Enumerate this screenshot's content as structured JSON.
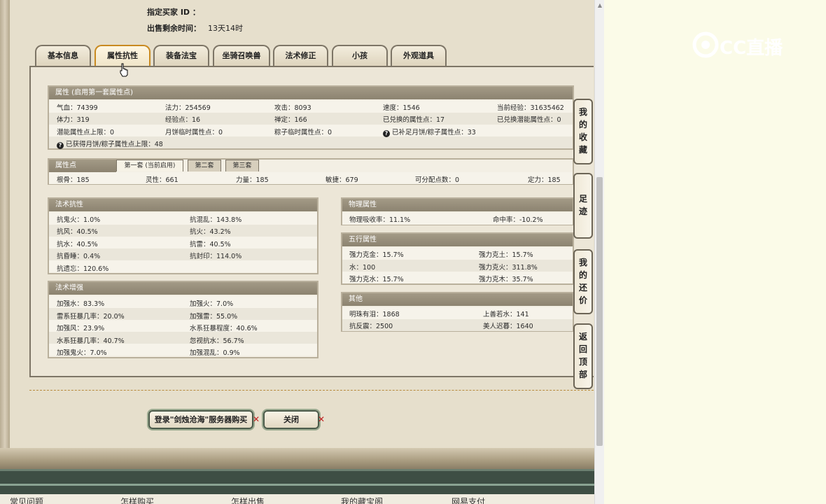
{
  "header": {
    "buyer_id_label": "指定买家 ID ：",
    "time_label": "出售剩余时间：",
    "time_value": "13天14时"
  },
  "tabs": [
    "基本信息",
    "属性抗性",
    "装备法宝",
    "坐骑召唤兽",
    "法术修正",
    "小孩",
    "外观道具"
  ],
  "active_tab": "属性抗性",
  "attributes": {
    "title": "属性 (启用第一套属性点)",
    "items": [
      "气血：74399",
      "法力：254569",
      "攻击：8093",
      "速度：1546",
      "当前经验：31635462",
      "体力：319",
      "经验点：16",
      "禅定：166",
      "已兑换的属性点：17",
      "已兑换潜能属性点：0",
      "潜能属性点上限：0",
      "月饼临时属性点：0",
      "粽子临时属性点：0",
      "已补足月饼/粽子属性点：33",
      "已获得月饼/粽子属性点上限：48"
    ]
  },
  "points": {
    "title": "属性点",
    "subtabs": [
      "第一套 (当前启用)",
      "第二套",
      "第三套"
    ],
    "items": [
      "根骨：185",
      "灵性：661",
      "力量：185",
      "敏捷：679",
      "可分配点数：0",
      "定力：185"
    ]
  },
  "resist": {
    "title": "法术抗性",
    "items": [
      "抗鬼火：1.0%",
      "抗混乱：143.8%",
      "抗风：40.5%",
      "抗火：43.2%",
      "抗水：40.5%",
      "抗雷：40.5%",
      "抗昏睡：0.4%",
      "抗封印：114.0%",
      "抗遗忘：120.6%"
    ]
  },
  "enhance": {
    "title": "法术增强",
    "items": [
      "加强水：83.3%",
      "加强火：7.0%",
      "雷系狂暴几率：20.0%",
      "加强雷：55.0%",
      "加强风：23.9%",
      "水系狂暴程度：40.6%",
      "水系狂暴几率：40.7%",
      "忽视抗水：56.7%",
      "加强鬼火：7.0%",
      "加强混乱：0.9%"
    ]
  },
  "physical": {
    "title": "物理属性",
    "items": [
      "物理吸收率：11.1%",
      "命中率：-10.2%"
    ]
  },
  "wuxing": {
    "title": "五行属性",
    "items": [
      "强力克金：15.7%",
      "强力克土：15.7%",
      "水：100",
      "强力克火：311.8%",
      "强力克水：15.7%",
      "强力克木：35.7%"
    ]
  },
  "other": {
    "title": "其他",
    "items": [
      "明珠有泪：1868",
      "上善若水：141",
      "抗反震：2500",
      "美人迟暮：1640"
    ]
  },
  "side_tabs": [
    [
      "我",
      "的",
      "收",
      "藏"
    ],
    [
      "足",
      "迹"
    ],
    [
      "我",
      "的",
      "还",
      "价"
    ],
    [
      "返",
      "回",
      "顶",
      "部"
    ]
  ],
  "buttons": {
    "login_buy": "登录\"剑烛沧海\"服务器购买",
    "close": "关闭"
  },
  "footer_links": [
    "常见问题",
    "怎样购买",
    "怎样出售",
    "我的藏宝阁",
    "网易支付"
  ],
  "watermark": "CC直播"
}
